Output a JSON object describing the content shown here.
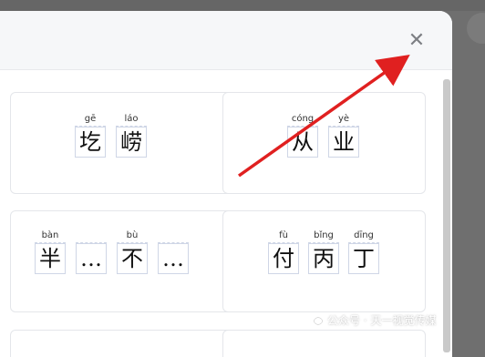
{
  "dialog": {
    "close_icon": "close-icon"
  },
  "cards": [
    {
      "id": "card-1",
      "chars": [
        {
          "pinyin": "gē",
          "hanzi": "圪"
        },
        {
          "pinyin": "láo",
          "hanzi": "崂"
        }
      ]
    },
    {
      "id": "card-2",
      "chars": [
        {
          "pinyin": "cóng",
          "hanzi": "从"
        },
        {
          "pinyin": "yè",
          "hanzi": "业"
        }
      ]
    },
    {
      "id": "card-3",
      "chars": [
        {
          "pinyin": "bàn",
          "hanzi": "半"
        },
        {
          "pinyin": "",
          "hanzi": "…"
        },
        {
          "pinyin": "bù",
          "hanzi": "不"
        },
        {
          "pinyin": "",
          "hanzi": "…"
        }
      ]
    },
    {
      "id": "card-4",
      "chars": [
        {
          "pinyin": "fù",
          "hanzi": "付"
        },
        {
          "pinyin": "bǐng",
          "hanzi": "丙"
        },
        {
          "pinyin": "dīng",
          "hanzi": "丁"
        }
      ]
    }
  ],
  "watermark": {
    "text": "公众号 · 天一视觉传媒"
  },
  "annotation": {
    "arrow_color": "#e02020"
  }
}
